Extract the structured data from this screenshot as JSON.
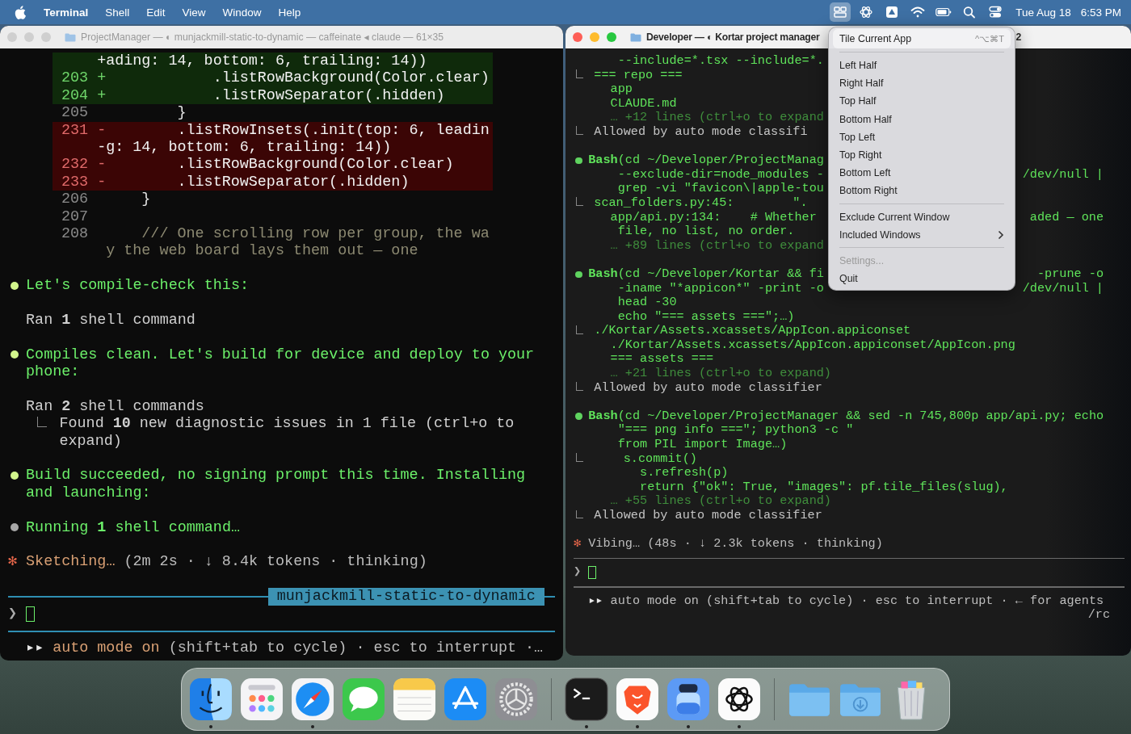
{
  "menubar": {
    "app": "Terminal",
    "menus": [
      "Shell",
      "Edit",
      "View",
      "Window",
      "Help"
    ],
    "status_icons": [
      {
        "kind": "tile",
        "selected": true
      },
      {
        "kind": "knot",
        "selected": false
      },
      {
        "kind": "drive",
        "selected": false
      },
      {
        "kind": "wifi",
        "selected": false
      },
      {
        "kind": "battery",
        "selected": false
      },
      {
        "kind": "search",
        "selected": false
      },
      {
        "kind": "toggles",
        "selected": false
      }
    ],
    "date": "Tue Aug 18",
    "time": "6:53 PM"
  },
  "left": {
    "active": false,
    "title": "ProjectManager — ◐ munjackmill-static-to-dynamic — caffeinate ◂ claude — 61×35",
    "diff": [
      {
        "kind": "add",
        "code": "+ading: 14, bottom: 6, trailing: 14))"
      },
      {
        "kind": "add",
        "num": "203",
        "sign": "+",
        "code": "           .listRowBackground(Color.clear)"
      },
      {
        "kind": "add",
        "num": "204",
        "sign": "+",
        "code": "           .listRowSeparator(.hidden)"
      },
      {
        "kind": "ctx",
        "num": "205",
        "code": "         }"
      },
      {
        "kind": "del",
        "num": "231",
        "sign": "-",
        "code": "       .listRowInsets(.init(top: 6, leadin"
      },
      {
        "kind": "del",
        "code": "-g: 14, bottom: 6, trailing: 14))"
      },
      {
        "kind": "del",
        "num": "232",
        "sign": "-",
        "code": "       .listRowBackground(Color.clear)"
      },
      {
        "kind": "del",
        "num": "233",
        "sign": "-",
        "code": "       .listRowSeparator(.hidden)"
      },
      {
        "kind": "ctx",
        "num": "206",
        "code": "     }"
      },
      {
        "kind": "ctx",
        "num": "207"
      },
      {
        "kind": "comment",
        "num": "208",
        "code": "     /// One scrolling row per group, the wa"
      },
      {
        "kind": "comment",
        "code": " y the web board lays them out — one"
      }
    ],
    "entries": [
      {
        "kind": "message",
        "color": "#d2f58c",
        "text": "Let's compile-check this:"
      },
      {
        "kind": "ran",
        "text": "Ran **1** shell command"
      },
      {
        "kind": "message",
        "color": "#d2f58c",
        "text": "Compiles clean. Let's build for device and deploy to your phone:"
      },
      {
        "kind": "ran",
        "text": "Ran **2** shell commands"
      },
      {
        "kind": "result",
        "text": "Found **10** new diagnostic issues in 1 file (ctrl+o to expand)"
      },
      {
        "kind": "message",
        "color": "#d2f58c",
        "text": "Build succeeded, no signing prompt this time. Installing and launching:"
      },
      {
        "kind": "message",
        "color": "#a8a8a8",
        "text": "Running **1** shell command…"
      }
    ],
    "status": {
      "spinner": "✻",
      "verb": "Sketching…",
      "detail": "(2m 2s · ↓ 8.4k tokens · thinking)"
    },
    "branch": "munjackmill-static-to-dynamic",
    "prompt": "❯",
    "footer": {
      "arrows": "▸▸",
      "mode": "auto mode on",
      "hint": "(shift+tab to cycle) · esc to interrupt ·…"
    }
  },
  "right": {
    "active": true,
    "title": "Developer — ◐ Kortar project manager",
    "title_tail": "2",
    "blocks": [
      {
        "lines": [
          {
            "kind": "cont",
            "text": "--include=*.tsx --include=*."
          },
          {
            "kind": "tree",
            "text": "=== repo ==="
          },
          {
            "kind": "out",
            "text": "app"
          },
          {
            "kind": "out",
            "text": "CLAUDE.md"
          },
          {
            "kind": "dim",
            "text": "… +12 lines (ctrl+o to expand"
          },
          {
            "kind": "note",
            "text": "Allowed by auto mode classifi"
          }
        ]
      },
      {
        "lines": [
          {
            "kind": "bash",
            "color": "#5fd35f",
            "text": "**Bash**(cd ~/Developer/ProjectManag"
          },
          {
            "kind": "cont",
            "text": "--exclude-dir=node_modules -",
            "right": "/dev/null |"
          },
          {
            "kind": "cont",
            "text": "grep -vi \"favicon\\|apple-tou"
          },
          {
            "kind": "tree",
            "text": "scan_folders.py:45:        \"."
          },
          {
            "kind": "out",
            "text": "app/api.py:134:    # Whether",
            "right": "aded — one"
          },
          {
            "kind": "cont",
            "text": "file, no list, no order."
          },
          {
            "kind": "dim",
            "text": "… +89 lines (ctrl+o to expand"
          }
        ]
      },
      {
        "lines": [
          {
            "kind": "bash",
            "color": "#5fd35f",
            "text": "**Bash**(cd ~/Developer/Kortar && fi",
            "right": "-prune -o"
          },
          {
            "kind": "cont",
            "text": "-iname \"*appicon*\" -print -o",
            "right": "/dev/null |"
          },
          {
            "kind": "cont",
            "text": "head -30"
          },
          {
            "kind": "cont",
            "text": "echo \"=== assets ===\";…)"
          },
          {
            "kind": "tree",
            "text": "./Kortar/Assets.xcassets/AppIcon.appiconset"
          },
          {
            "kind": "out",
            "text": "./Kortar/Assets.xcassets/AppIcon.appiconset/AppIcon.png"
          },
          {
            "kind": "out",
            "text": "=== assets ==="
          },
          {
            "kind": "dim",
            "text": "… +21 lines (ctrl+o to expand)"
          },
          {
            "kind": "note",
            "text": "Allowed by auto mode classifier"
          }
        ]
      },
      {
        "lines": [
          {
            "kind": "bash",
            "color": "#5fd35f",
            "text": "**Bash**(cd ~/Developer/ProjectManager && sed -n 745,800p app/api.py; echo"
          },
          {
            "kind": "cont",
            "text": "\"=== png info ===\"; python3 -c \""
          },
          {
            "kind": "cont",
            "text": "from PIL import Image…)"
          },
          {
            "kind": "tree",
            "text": "    s.commit()"
          },
          {
            "kind": "out",
            "text": "    s.refresh(p)"
          },
          {
            "kind": "out",
            "text": "    return {\"ok\": True, \"images\": pf.tile_files(slug),"
          },
          {
            "kind": "dim",
            "text": "… +55 lines (ctrl+o to expand)"
          },
          {
            "kind": "note",
            "text": "Allowed by auto mode classifier"
          }
        ]
      }
    ],
    "status": {
      "spinner": "✻",
      "verb": "Vibing…",
      "detail": "(48s · ↓ 2.3k tokens · thinking)"
    },
    "prompt": "❯",
    "footer": {
      "arrows": "▸▸",
      "mode": "auto mode on",
      "hint": "(shift+tab to cycle) · esc to interrupt · ← for agents",
      "tail": "/rc"
    }
  },
  "menu": {
    "header": {
      "label": "Tile Current App",
      "shortcut": "^⌥⌘T"
    },
    "groups": [
      [
        {
          "label": "Left Half",
          "kind": "action",
          "disabled": false
        },
        {
          "label": "Right Half",
          "kind": "action",
          "disabled": false
        },
        {
          "label": "Top Half",
          "kind": "action",
          "disabled": false
        },
        {
          "label": "Bottom Half",
          "kind": "action",
          "disabled": false
        },
        {
          "label": "Top Left",
          "kind": "action",
          "disabled": false
        },
        {
          "label": "Top Right",
          "kind": "action",
          "disabled": false
        },
        {
          "label": "Bottom Left",
          "kind": "action",
          "disabled": false
        },
        {
          "label": "Bottom Right",
          "kind": "action",
          "disabled": false
        }
      ],
      [
        {
          "label": "Exclude Current Window",
          "kind": "action",
          "disabled": false
        },
        {
          "label": "Included Windows",
          "kind": "submenu",
          "disabled": false
        }
      ],
      [
        {
          "label": "Settings...",
          "kind": "action",
          "disabled": true
        },
        {
          "label": "Quit",
          "kind": "action",
          "disabled": false
        }
      ]
    ]
  },
  "dock": {
    "groups": [
      [
        {
          "kind": "finder",
          "running": true
        },
        {
          "kind": "launchpad",
          "running": false
        },
        {
          "kind": "safari",
          "running": true
        },
        {
          "kind": "messages",
          "running": false
        },
        {
          "kind": "notes",
          "running": false
        },
        {
          "kind": "appstore",
          "running": false
        },
        {
          "kind": "settings",
          "running": false
        }
      ],
      [
        {
          "kind": "terminal",
          "running": true
        },
        {
          "kind": "brave",
          "running": true
        },
        {
          "kind": "jar",
          "running": true
        },
        {
          "kind": "chatgpt",
          "running": true
        }
      ],
      [
        {
          "kind": "folder",
          "running": false
        },
        {
          "kind": "downloads",
          "running": false
        },
        {
          "kind": "trash",
          "running": false
        }
      ]
    ]
  }
}
